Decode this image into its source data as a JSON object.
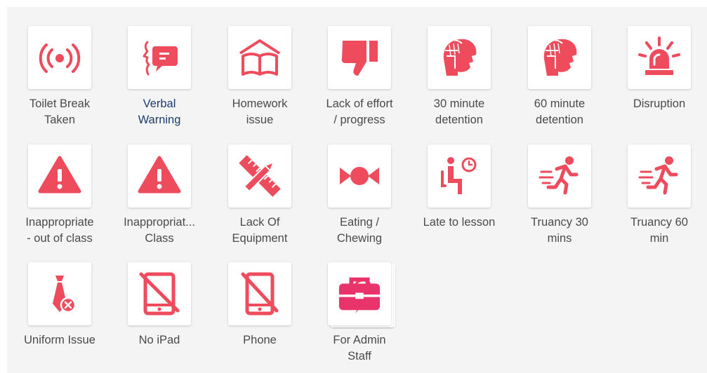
{
  "accent_color": "#ee4b5c",
  "label_color": "#4a4a4a",
  "selected_label_color": "#1d3c6e",
  "badge_color": "#e8336b",
  "behaviours": [
    {
      "id": "toilet",
      "label": "Toilet Break\nTaken",
      "icon": "broadcast-signal-icon"
    },
    {
      "id": "verbal",
      "label": "Verbal\nWarning",
      "icon": "speaking-head-icon",
      "selected": true
    },
    {
      "id": "homework",
      "label": "Homework\nissue",
      "icon": "open-book-icon"
    },
    {
      "id": "effort",
      "label": "Lack of effort\n/ progress",
      "icon": "thumbs-down-icon"
    },
    {
      "id": "det30",
      "label": "30 minute\ndetention",
      "icon": "spartan-helmet-icon"
    },
    {
      "id": "det60",
      "label": "60 minute\ndetention",
      "icon": "spartan-helmet-icon"
    },
    {
      "id": "disruption",
      "label": "Disruption",
      "icon": "siren-icon"
    },
    {
      "id": "inappropriate-out",
      "label": "Inappropriate\n- out of class",
      "icon": "warning-triangle-icon"
    },
    {
      "id": "inappropriate-class",
      "label": "Inappropriat...\nClass",
      "icon": "warning-triangle-icon"
    },
    {
      "id": "equipment",
      "label": "Lack Of\nEquipment",
      "icon": "ruler-pencil-icon"
    },
    {
      "id": "eating",
      "label": "Eating /\nChewing",
      "icon": "candy-icon"
    },
    {
      "id": "late",
      "label": "Late to lesson",
      "icon": "seated-person-clock-icon"
    },
    {
      "id": "truancy30",
      "label": "Truancy 30\nmins",
      "icon": "running-person-icon"
    },
    {
      "id": "truancy60",
      "label": "Truancy 60\nmin",
      "icon": "running-person-icon"
    },
    {
      "id": "uniform",
      "label": "Uniform Issue",
      "icon": "tie-cross-icon"
    },
    {
      "id": "ipad",
      "label": "No iPad",
      "icon": "no-tablet-icon"
    },
    {
      "id": "phone",
      "label": "Phone",
      "icon": "no-phone-icon"
    },
    {
      "id": "admin",
      "label": "For Admin\nStaff",
      "icon": "storm-cloud-icon",
      "folder": true
    }
  ]
}
